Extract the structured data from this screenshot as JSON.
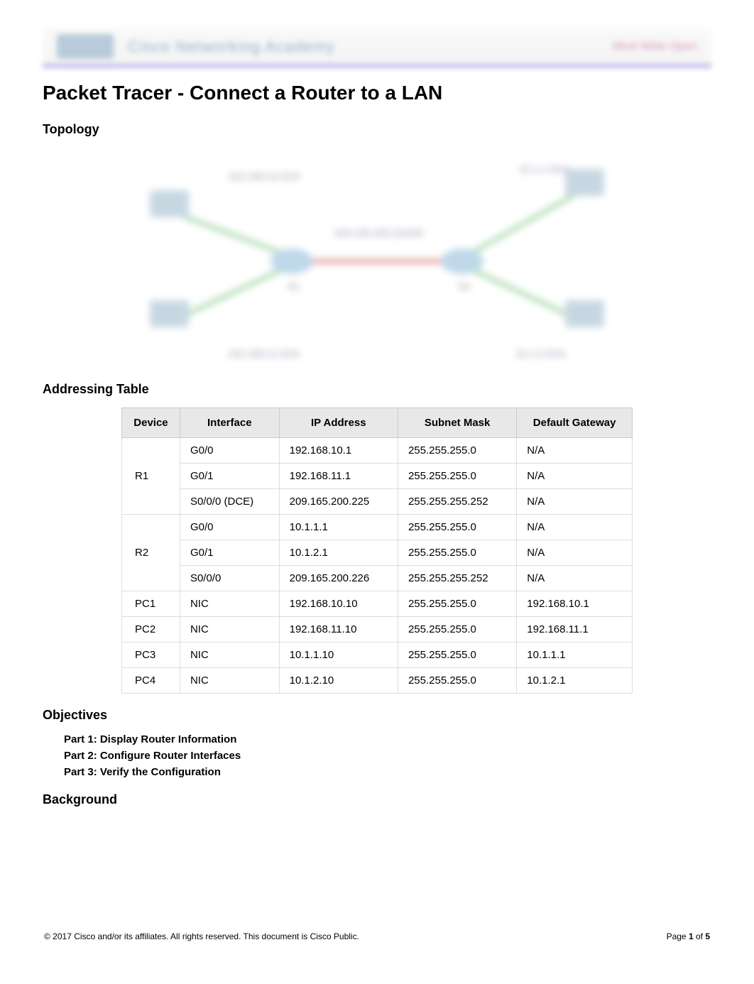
{
  "header": {
    "logo_alt": "Cisco",
    "brand_text": "Cisco Networking Academy",
    "right_text": "Mind Wide Open"
  },
  "title": "Packet Tracer - Connect a Router to a LAN",
  "sections": {
    "topology": "Topology",
    "addressing": "Addressing Table",
    "objectives": "Objectives",
    "background": "Background"
  },
  "topology_labels": {
    "net_top_left": "192.168.10.0/24",
    "net_top_right": "10.1.1.0/24",
    "net_mid": "209.165.200.224/30",
    "net_bot_left": "192.168.11.0/24",
    "net_bot_right": "10.1.2.0/24",
    "r1": "R1",
    "r2": "R2"
  },
  "addressing_table": {
    "headers": [
      "Device",
      "Interface",
      "IP Address",
      "Subnet Mask",
      "Default Gateway"
    ],
    "rows": [
      {
        "device": "R1",
        "rowspan": 3,
        "interface": "G0/0",
        "ip": "192.168.10.1",
        "mask": "255.255.255.0",
        "gw": "N/A"
      },
      {
        "device": "",
        "rowspan": 0,
        "interface": "G0/1",
        "ip": "192.168.11.1",
        "mask": "255.255.255.0",
        "gw": "N/A"
      },
      {
        "device": "",
        "rowspan": 0,
        "interface": "S0/0/0 (DCE)",
        "ip": "209.165.200.225",
        "mask": "255.255.255.252",
        "gw": "N/A"
      },
      {
        "device": "R2",
        "rowspan": 3,
        "interface": "G0/0",
        "ip": "10.1.1.1",
        "mask": "255.255.255.0",
        "gw": "N/A"
      },
      {
        "device": "",
        "rowspan": 0,
        "interface": "G0/1",
        "ip": "10.1.2.1",
        "mask": "255.255.255.0",
        "gw": "N/A"
      },
      {
        "device": "",
        "rowspan": 0,
        "interface": "S0/0/0",
        "ip": "209.165.200.226",
        "mask": "255.255.255.252",
        "gw": "N/A"
      },
      {
        "device": "PC1",
        "rowspan": 1,
        "interface": "NIC",
        "ip": "192.168.10.10",
        "mask": "255.255.255.0",
        "gw": "192.168.10.1"
      },
      {
        "device": "PC2",
        "rowspan": 1,
        "interface": "NIC",
        "ip": "192.168.11.10",
        "mask": "255.255.255.0",
        "gw": "192.168.11.1"
      },
      {
        "device": "PC3",
        "rowspan": 1,
        "interface": "NIC",
        "ip": "10.1.1.10",
        "mask": "255.255.255.0",
        "gw": "10.1.1.1"
      },
      {
        "device": "PC4",
        "rowspan": 1,
        "interface": "NIC",
        "ip": "10.1.2.10",
        "mask": "255.255.255.0",
        "gw": "10.1.2.1"
      }
    ]
  },
  "objectives": [
    "Part 1: Display Router Information",
    "Part 2: Configure Router Interfaces",
    "Part 3: Verify the Configuration"
  ],
  "footer": {
    "copyright": "© 2017 Cisco and/or its affiliates. All rights reserved. This document is Cisco Public.",
    "page_prefix": "Page ",
    "page_current": "1",
    "page_sep": " of ",
    "page_total": "5"
  }
}
